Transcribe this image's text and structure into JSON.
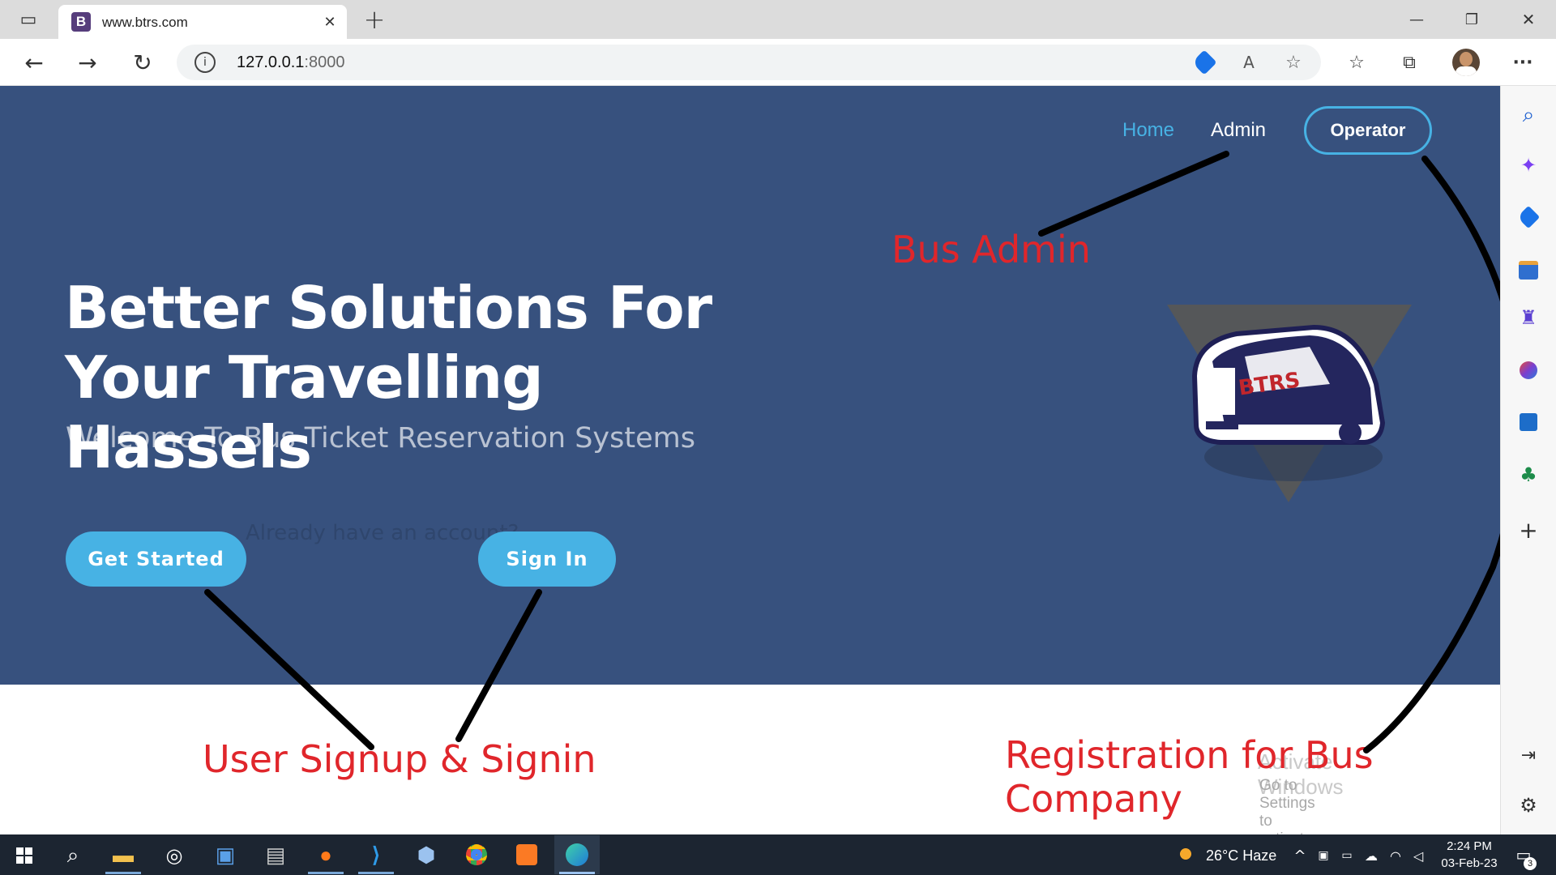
{
  "browser": {
    "tab_favicon": "B",
    "tab_title": "www.btrs.com",
    "tab_close": "✕",
    "new_tab": "+",
    "url_host": "127.0.0.1",
    "url_port": ":8000",
    "window_controls": [
      "—",
      "❐",
      "✕"
    ],
    "more": "···"
  },
  "nav": {
    "home": "Home",
    "admin": "Admin",
    "operator": "Operator"
  },
  "hero": {
    "title_line1": "Better Solutions For",
    "title_line2": "Your Travelling Hassels",
    "subtitle": "Welcome To Bus Ticket Reservation Systems",
    "get_started": "Get Started",
    "already": "Already have an account?",
    "sign_in": "Sign In",
    "logo_text": "BTRS"
  },
  "annotations": {
    "bus_admin": "Bus Admin",
    "user_signup": "User Signup & Signin",
    "registration": "Registration for Bus Company"
  },
  "watermark": {
    "line1": "Activate Windows",
    "line2": "Go to Settings to activate Windows."
  },
  "taskbar": {
    "weather": "26°C  Haze",
    "time": "2:24 PM",
    "date": "03-Feb-23",
    "notifications": "3"
  },
  "colors": {
    "hero_bg": "#37517e",
    "accent": "#47b2e4",
    "annotation_red": "#e0262b"
  }
}
